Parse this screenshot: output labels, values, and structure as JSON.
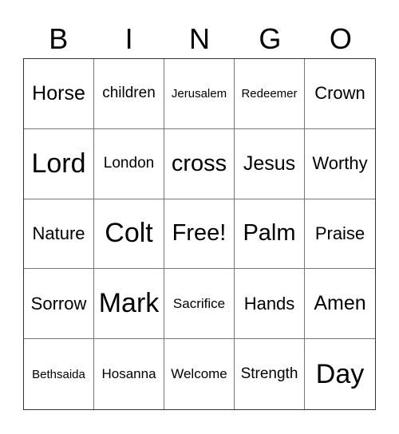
{
  "header": [
    "B",
    "I",
    "N",
    "G",
    "O"
  ],
  "cells": [
    {
      "text": "Horse",
      "size": "s5"
    },
    {
      "text": "children",
      "size": "s3"
    },
    {
      "text": "Jerusalem",
      "size": "s1"
    },
    {
      "text": "Redeemer",
      "size": "s1"
    },
    {
      "text": "Crown",
      "size": "s4"
    },
    {
      "text": "Lord",
      "size": "s7"
    },
    {
      "text": "London",
      "size": "s3"
    },
    {
      "text": "cross",
      "size": "s6"
    },
    {
      "text": "Jesus",
      "size": "s5"
    },
    {
      "text": "Worthy",
      "size": "s4"
    },
    {
      "text": "Nature",
      "size": "s4"
    },
    {
      "text": "Colt",
      "size": "s7"
    },
    {
      "text": "Free!",
      "size": "s6"
    },
    {
      "text": "Palm",
      "size": "s6"
    },
    {
      "text": "Praise",
      "size": "s4"
    },
    {
      "text": "Sorrow",
      "size": "s4"
    },
    {
      "text": "Mark",
      "size": "s7"
    },
    {
      "text": "Sacrifice",
      "size": "s2"
    },
    {
      "text": "Hands",
      "size": "s4"
    },
    {
      "text": "Amen",
      "size": "s5"
    },
    {
      "text": "Bethsaida",
      "size": "s1"
    },
    {
      "text": "Hosanna",
      "size": "s2"
    },
    {
      "text": "Welcome",
      "size": "s2"
    },
    {
      "text": "Strength",
      "size": "s3"
    },
    {
      "text": "Day",
      "size": "s7"
    }
  ]
}
